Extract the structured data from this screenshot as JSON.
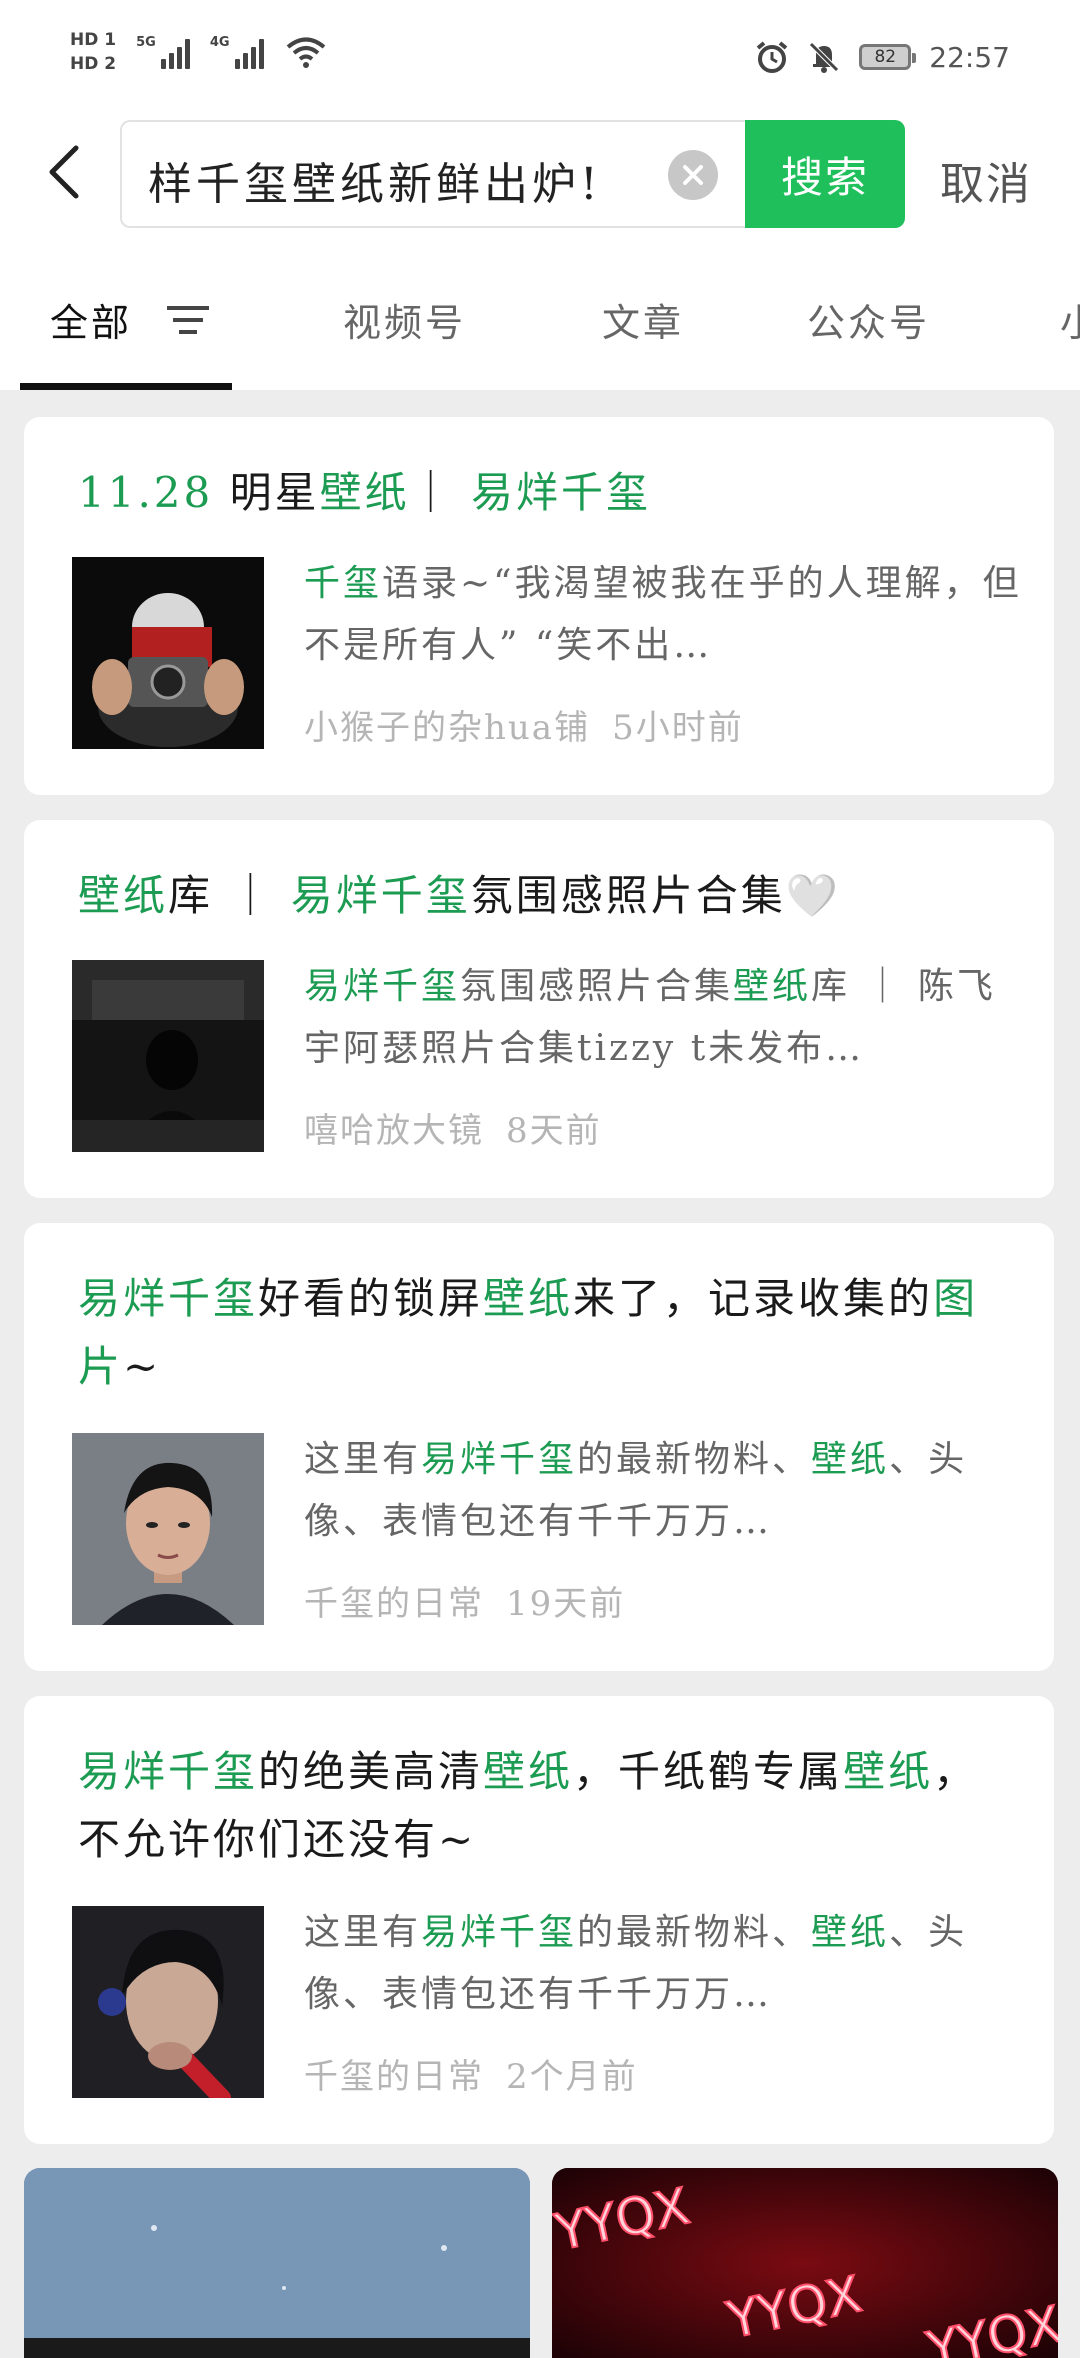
{
  "status_bar": {
    "hd1": "HD 1",
    "hd2": "HD 2",
    "net1": "5G",
    "net2": "4G",
    "battery": "82",
    "time": "22:57"
  },
  "search": {
    "query": "样千玺壁纸新鲜出炉!",
    "button": "搜索",
    "cancel": "取消"
  },
  "tabs": [
    "全部",
    "视频号",
    "文章",
    "公众号",
    "小"
  ],
  "colors": {
    "accent": "#1fbf5c",
    "highlight": "#1c9b52"
  },
  "results": [
    {
      "title_parts": [
        {
          "text": "11.28",
          "hl": true
        },
        {
          "text": " 明星",
          "hl": false
        },
        {
          "text": "壁纸",
          "hl": true
        },
        {
          "text": "｜ ",
          "hl": false
        },
        {
          "text": "易烊千玺",
          "hl": true
        }
      ],
      "desc_parts": [
        {
          "text": "千玺",
          "hl": true
        },
        {
          "text": "语录~“我渴望被我在乎的人理解，但不是所有人” “笑不出…",
          "hl": false
        }
      ],
      "source": "小猴子的杂hua铺",
      "time": "5小时前"
    },
    {
      "title_parts": [
        {
          "text": "壁纸",
          "hl": true
        },
        {
          "text": "库 ｜ ",
          "hl": false
        },
        {
          "text": "易烊千玺",
          "hl": true
        },
        {
          "text": "氛围感照片合集🤍",
          "hl": false
        }
      ],
      "desc_parts": [
        {
          "text": "易烊千玺",
          "hl": true
        },
        {
          "text": "氛围感照片合集",
          "hl": false
        },
        {
          "text": "壁纸",
          "hl": true
        },
        {
          "text": "库 ｜ 陈飞宇阿瑟照片合集tizzy t未发布…",
          "hl": false
        }
      ],
      "source": "嘻哈放大镜",
      "time": "8天前"
    },
    {
      "title_parts": [
        {
          "text": "易烊千玺",
          "hl": true
        },
        {
          "text": "好看的锁屏",
          "hl": false
        },
        {
          "text": "壁纸",
          "hl": true
        },
        {
          "text": "来了，记录收集的",
          "hl": false
        },
        {
          "text": "图片",
          "hl": true
        },
        {
          "text": "~",
          "hl": false
        }
      ],
      "desc_parts": [
        {
          "text": "这里有",
          "hl": false
        },
        {
          "text": "易烊千玺",
          "hl": true
        },
        {
          "text": "的最新物料、",
          "hl": false
        },
        {
          "text": "壁纸",
          "hl": true
        },
        {
          "text": "、头像、表情包还有千千万万…",
          "hl": false
        }
      ],
      "source": "千玺的日常",
      "time": "19天前"
    },
    {
      "title_parts": [
        {
          "text": "易烊千玺",
          "hl": true
        },
        {
          "text": "的绝美高清",
          "hl": false
        },
        {
          "text": "壁纸",
          "hl": true
        },
        {
          "text": "，千纸鹤专属",
          "hl": false
        },
        {
          "text": "壁纸",
          "hl": true
        },
        {
          "text": "，不允许你们还没有~",
          "hl": false
        }
      ],
      "desc_parts": [
        {
          "text": "这里有",
          "hl": false
        },
        {
          "text": "易烊千玺",
          "hl": true
        },
        {
          "text": "的最新物料、",
          "hl": false
        },
        {
          "text": "壁纸",
          "hl": true
        },
        {
          "text": "、头像、表情包还有千千万万…",
          "hl": false
        }
      ],
      "source": "千玺的日常",
      "time": "2个月前"
    }
  ],
  "bottom_cards": [
    {
      "text": ""
    },
    {
      "text": "YYQX"
    }
  ]
}
